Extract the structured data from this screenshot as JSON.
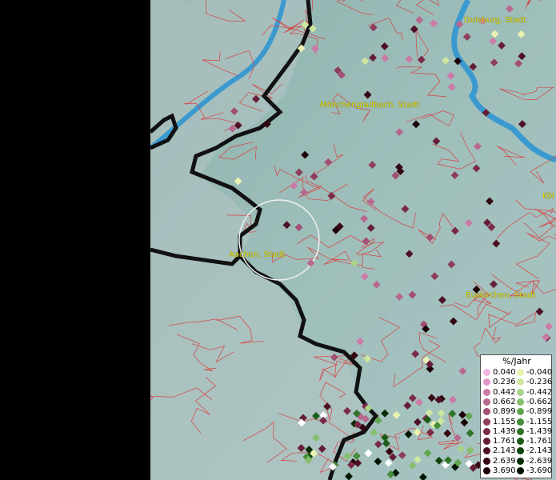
{
  "cities": [
    {
      "name": "Duisburg, Stadt"
    },
    {
      "name": "Mönchengladbach, Stadt"
    },
    {
      "name": "Aachen, Stadt"
    },
    {
      "name": "Euskirchen, Stadt"
    },
    {
      "name": "Köl"
    }
  ],
  "legend": {
    "title": "%/Jahr",
    "positive": [
      {
        "label": "0.040",
        "color": "#f2b6e2"
      },
      {
        "label": "0.236",
        "color": "#e296c8"
      },
      {
        "label": "0.442",
        "color": "#cc7aa8"
      },
      {
        "label": "0.662",
        "color": "#b8688e"
      },
      {
        "label": "0.899",
        "color": "#a34e72"
      },
      {
        "label": "1.155",
        "color": "#8e3d5e"
      },
      {
        "label": "1.439",
        "color": "#7a2a48"
      },
      {
        "label": "1.761",
        "color": "#661d38"
      },
      {
        "label": "2.143",
        "color": "#4d1024"
      },
      {
        "label": "2.639",
        "color": "#340612"
      },
      {
        "label": "3.690",
        "color": "#1a0006"
      }
    ],
    "negative": [
      {
        "label": "-0.040",
        "color": "#eaf2b0"
      },
      {
        "label": "-0.236",
        "color": "#cfe6a0"
      },
      {
        "label": "-0.442",
        "color": "#a9d48a"
      },
      {
        "label": "-0.662",
        "color": "#86c06e"
      },
      {
        "label": "-0.899",
        "color": "#62a650"
      },
      {
        "label": "-1.155",
        "color": "#468c3a"
      },
      {
        "label": "-1.439",
        "color": "#2f7428"
      },
      {
        "label": "-1.761",
        "color": "#1e5c1a"
      },
      {
        "label": "-2.143",
        "color": "#10440e"
      },
      {
        "label": "-2.639",
        "color": "#072c06"
      },
      {
        "label": "-3.690",
        "color": "#001400"
      }
    ]
  }
}
